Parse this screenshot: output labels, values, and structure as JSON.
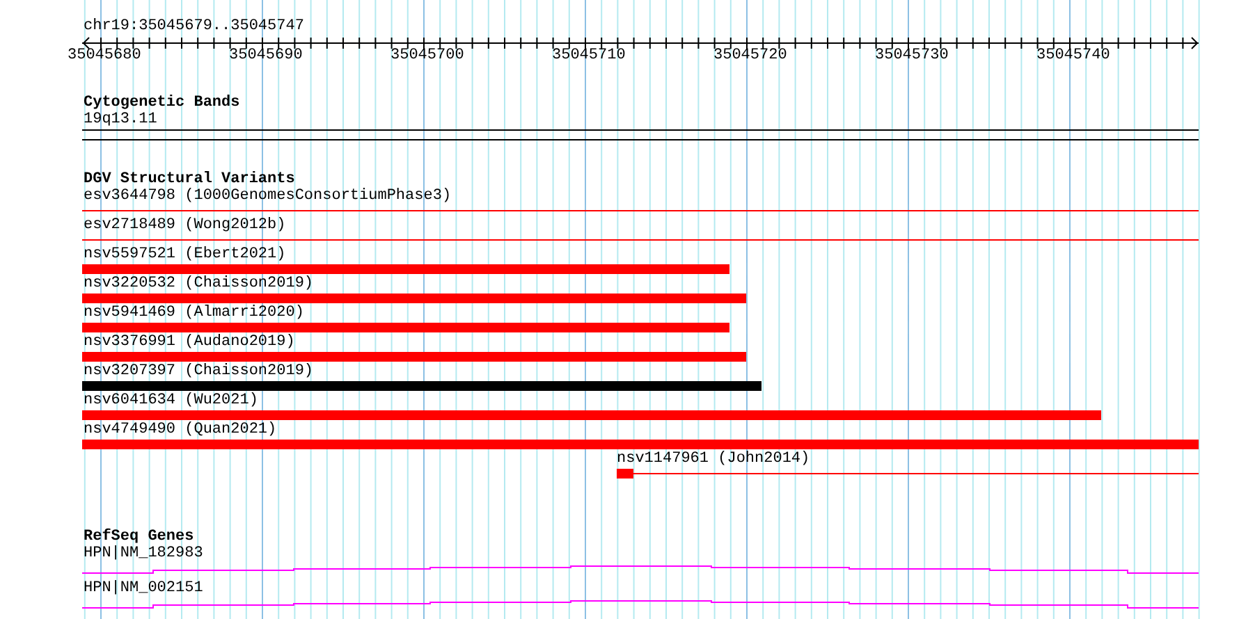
{
  "ruler": {
    "title": "chr19:35045679..35045747",
    "labels": [
      "35045680",
      "35045690",
      "35045700",
      "35045710",
      "35045720",
      "35045730",
      "35045740"
    ]
  },
  "cytogenetic": {
    "title": "Cytogenetic Bands",
    "band": "19q13.11"
  },
  "dgv": {
    "title": "DGV Structural Variants",
    "variants": [
      {
        "label": "esv3644798 (1000GenomesConsortiumPhase3)",
        "kind": "line",
        "color": "#ff0000",
        "level": 1
      },
      {
        "label": "esv2718489 (Wong2012b)",
        "kind": "line",
        "color": "#ff0000",
        "level": 1
      },
      {
        "label": "nsv5597521 (Ebert2021)",
        "kind": "bar",
        "color": "#ff0000",
        "level": 0.58
      },
      {
        "label": "nsv3220532 (Chaisson2019)",
        "kind": "bar",
        "color": "#ff0000",
        "level": 0.595
      },
      {
        "label": "nsv5941469 (Almarri2020)",
        "kind": "bar",
        "color": "#ff0000",
        "level": 0.58
      },
      {
        "label": "nsv3376991 (Audano2019)",
        "kind": "bar",
        "color": "#ff0000",
        "level": 0.595
      },
      {
        "label": "nsv3207397 (Chaisson2019)",
        "kind": "bar",
        "color": "#000000",
        "level": 0.609
      },
      {
        "label": "nsv6041634 (Wu2021)",
        "kind": "bar",
        "color": "#ff0000",
        "level": 0.913
      },
      {
        "label": "nsv4749490 (Quan2021)",
        "kind": "bar",
        "color": "#ff0000",
        "level": 1
      },
      {
        "label": "nsv1147961 (John2014)",
        "kind": "offset",
        "color": "#ff0000"
      }
    ]
  },
  "refseq": {
    "title": "RefSeq Genes",
    "genes": [
      "HPN|NM_182983",
      "HPN|NM_002151"
    ]
  }
}
